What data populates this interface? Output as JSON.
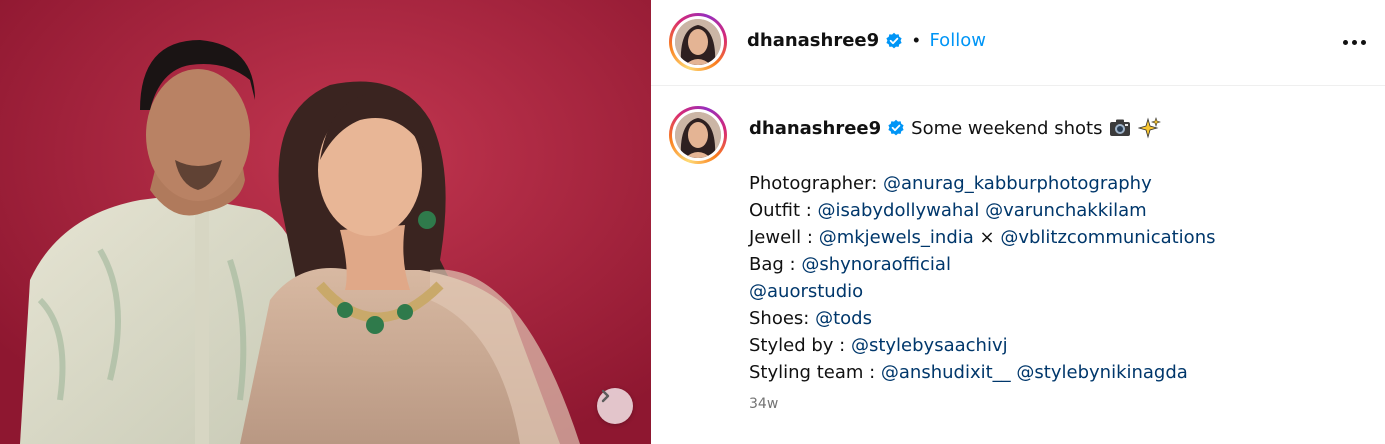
{
  "post": {
    "username": "dhanashree9",
    "follow_label": "Follow",
    "separator": "•",
    "verified_icon": "verified-badge-icon",
    "more_icon": "more-options-icon",
    "next_icon": "chevron-right-icon"
  },
  "caption": {
    "username": "dhanashree9",
    "text": "Some weekend shots",
    "emojis": [
      "camera-emoji",
      "sparkles-emoji"
    ],
    "lines": [
      {
        "label": "Photographer: ",
        "mentions": [
          "@anurag_kabburphotography"
        ],
        "joiner": ""
      },
      {
        "label": "Outfit : ",
        "mentions": [
          "@isabydollywahal",
          "@varunchakkilam"
        ],
        "joiner": " "
      },
      {
        "label": "Jewell : ",
        "mentions": [
          "@mkjewels_india",
          "@vblitzcommunications"
        ],
        "joiner": " × "
      },
      {
        "label": "Bag : ",
        "mentions": [
          "@shynoraofficial"
        ],
        "joiner": ""
      },
      {
        "label": "",
        "mentions": [
          "@auorstudio"
        ],
        "joiner": ""
      },
      {
        "label": "Shoes: ",
        "mentions": [
          "@tods"
        ],
        "joiner": ""
      },
      {
        "label": "Styled by : ",
        "mentions": [
          "@stylebysaachivj"
        ],
        "joiner": ""
      },
      {
        "label": "Styling team : ",
        "mentions": [
          "@anshudixit__",
          "@stylebynikinagda"
        ],
        "joiner": " "
      }
    ],
    "timestamp": "34w"
  },
  "colors": {
    "follow": "#0095f6",
    "mention": "#00376b",
    "timestamp": "#737373",
    "photo_background": "#a71f39"
  }
}
